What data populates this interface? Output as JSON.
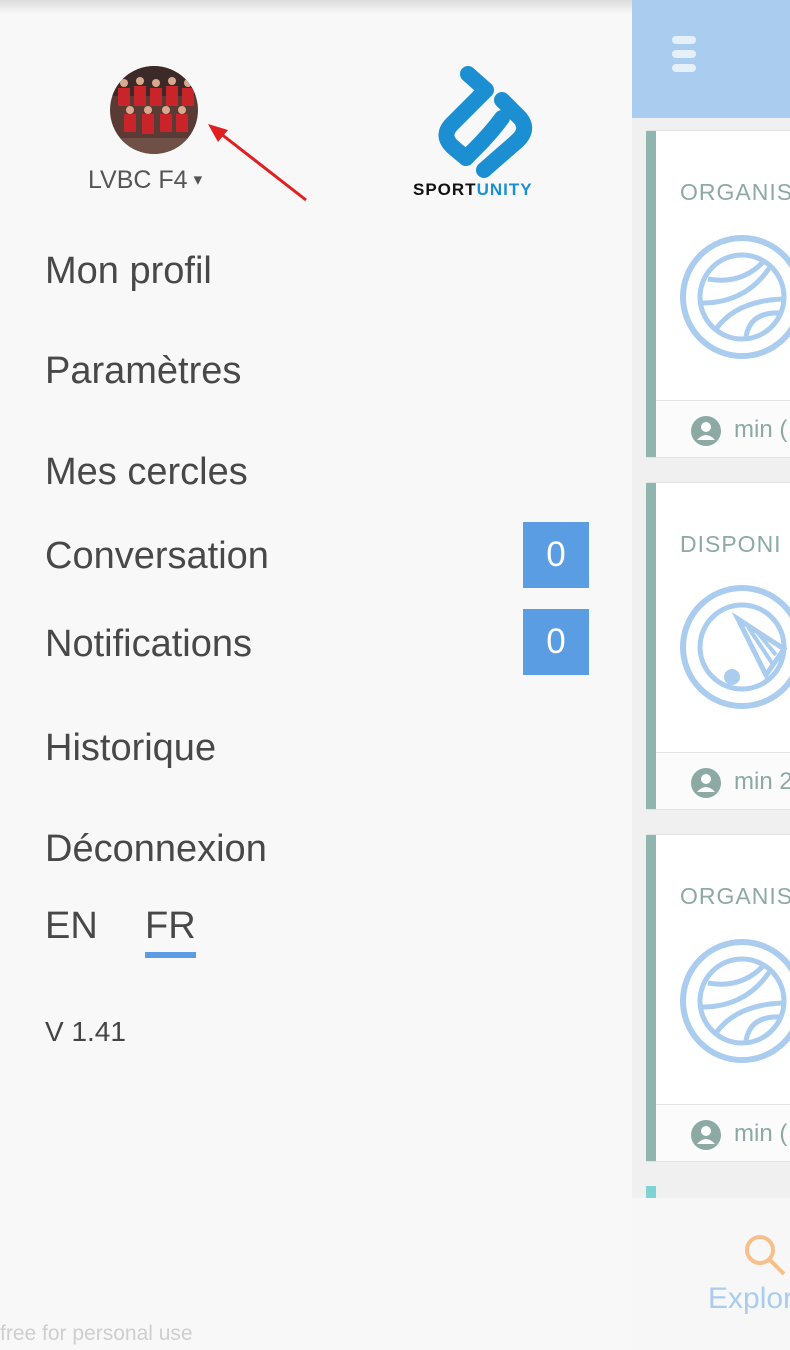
{
  "profile": {
    "team_name": "LVBC F4",
    "caret": "▾"
  },
  "brand": {
    "logo_word_a": "SPORT",
    "logo_word_b": "UNITY"
  },
  "menu": {
    "profile": "Mon profil",
    "settings": "Paramètres",
    "circles": "Mes cercles",
    "conversation": "Conversation",
    "conversation_count": "0",
    "notifications": "Notifications",
    "notifications_count": "0",
    "history": "Historique",
    "logout": "Déconnexion"
  },
  "languages": {
    "en": "EN",
    "fr": "FR",
    "selected": "FR"
  },
  "version": "V 1.41",
  "watermark": "free for personal use",
  "feed": {
    "cards": [
      {
        "category": "ORGANIS",
        "sport_icon": "volleyball-icon",
        "footer": "min ("
      },
      {
        "category": "DISPONI",
        "sport_icon": "badminton-icon",
        "footer": "min 2"
      },
      {
        "category": "ORGANIS",
        "sport_icon": "volleyball-icon",
        "footer": "min ("
      }
    ]
  },
  "bottom_nav": {
    "explore": "Explor"
  },
  "colors": {
    "accent": "#5b9de2",
    "header": "#a9ccef",
    "card_bar": "#8fb5ae",
    "arrow": "#e02020"
  }
}
